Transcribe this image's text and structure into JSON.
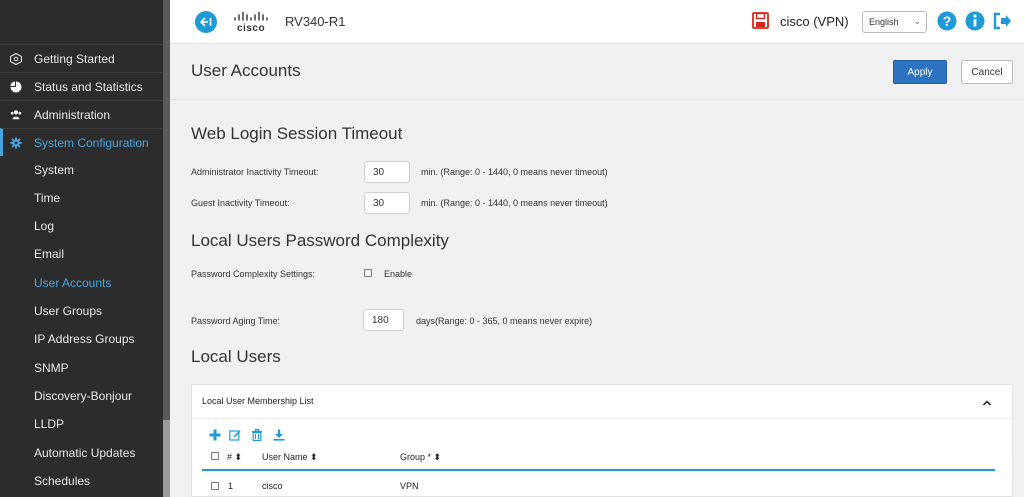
{
  "header": {
    "device_name": "RV340-R1",
    "logo_text": "cisco",
    "user": "cisco (VPN)",
    "language": "English",
    "icons": [
      "collapse-icon",
      "save-icon",
      "help-icon",
      "info-icon",
      "logout-icon"
    ]
  },
  "sidebar": {
    "items": [
      {
        "label": "Getting Started",
        "icon": "getting-started-icon"
      },
      {
        "label": "Status and Statistics",
        "icon": "pie-chart-icon"
      },
      {
        "label": "Administration",
        "icon": "users-icon"
      },
      {
        "label": "System Configuration",
        "icon": "gear-icon"
      }
    ],
    "sub_items": [
      "System",
      "Time",
      "Log",
      "Email",
      "User Accounts",
      "User Groups",
      "IP Address Groups",
      "SNMP",
      "Discovery-Bonjour",
      "LLDP",
      "Automatic Updates",
      "Schedules"
    ]
  },
  "page": {
    "title": "User Accounts",
    "apply_label": "Apply",
    "cancel_label": "Cancel"
  },
  "session": {
    "title": "Web Login Session Timeout",
    "admin_label": "Administrator Inactivity Timeout:",
    "admin_value": "30",
    "admin_hint": "min. (Range: 0 - 1440, 0 means never timeout)",
    "guest_label": "Guest Inactivity Timeout:",
    "guest_value": "30",
    "guest_hint": "min. (Range: 0 - 1440, 0 means never timeout)"
  },
  "complexity": {
    "title": "Local Users Password Complexity",
    "settings_label": "Password Complexity Settings:",
    "enable_label": "Enable",
    "enabled": false,
    "aging_label": "Password Aging Time:",
    "aging_value": "180",
    "aging_hint": "days(Range: 0 - 365, 0 means never expire)"
  },
  "local_users": {
    "title": "Local Users",
    "panel_title": "Local User Membership List",
    "toolbar_icons": [
      "add-icon",
      "edit-icon",
      "delete-icon",
      "download-icon"
    ],
    "columns": [
      "# ⬍",
      "User Name ⬍",
      "Group * ⬍"
    ],
    "rows": [
      {
        "num": "1",
        "user": "cisco",
        "group": "VPN"
      }
    ]
  },
  "colors": {
    "accent": "#1e9bd7",
    "apply": "#2b72c0",
    "sidebar_bg": "#2c2c2c",
    "active_nav": "#4aa3df",
    "save_icon": "#d9261c"
  }
}
